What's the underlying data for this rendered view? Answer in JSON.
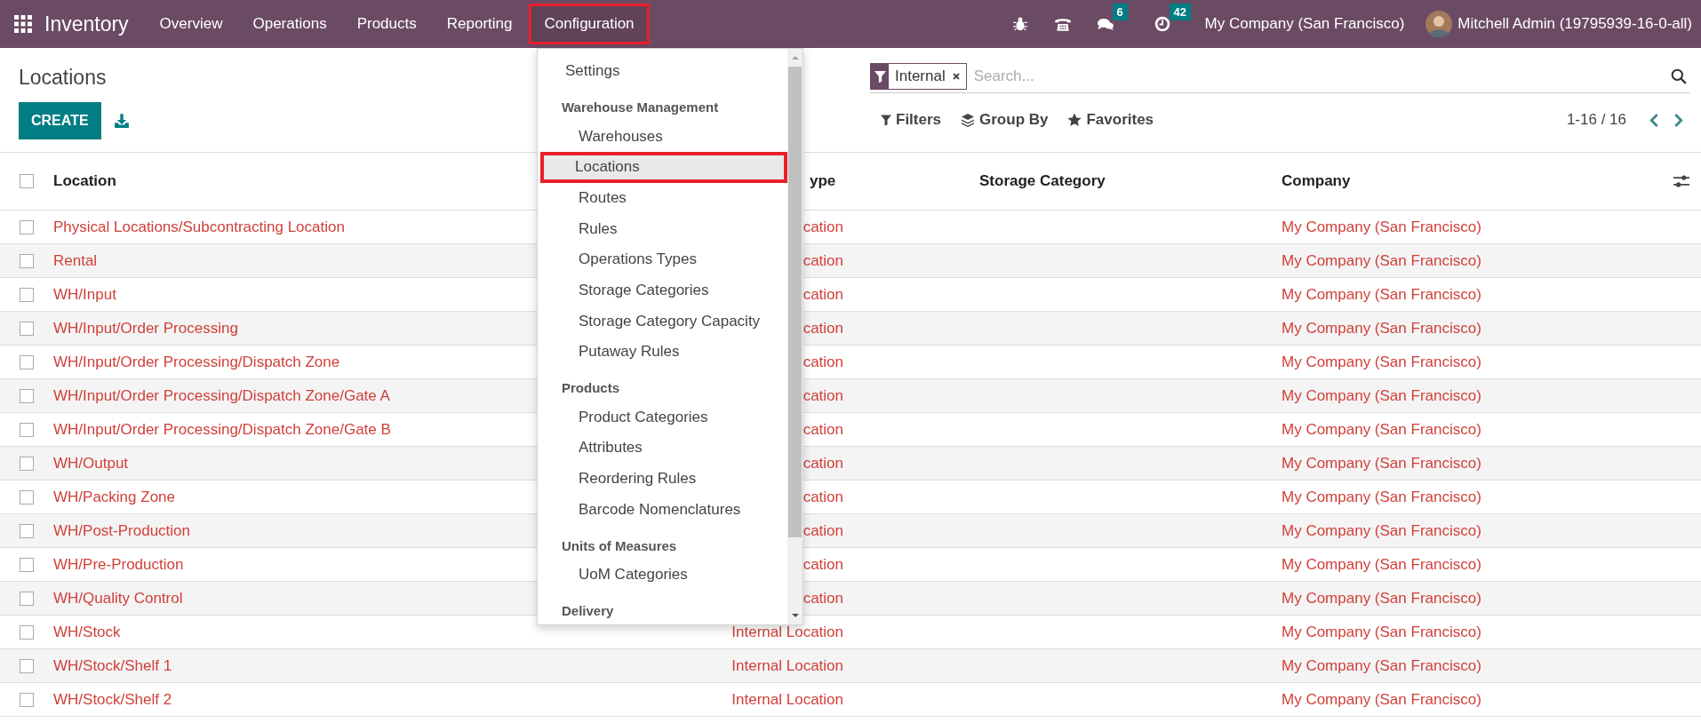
{
  "navbar": {
    "app_name": "Inventory",
    "menu": [
      {
        "label": "Overview",
        "selected": false
      },
      {
        "label": "Operations",
        "selected": false
      },
      {
        "label": "Products",
        "selected": false
      },
      {
        "label": "Reporting",
        "selected": false
      },
      {
        "label": "Configuration",
        "selected": true
      }
    ],
    "messages_badge": "6",
    "activities_badge": "42",
    "company": "My Company (San Francisco)",
    "user": "Mitchell Admin (19795939-16-0-all)"
  },
  "control_panel": {
    "title": "Locations",
    "create_button": "CREATE",
    "search": {
      "facet": "Internal",
      "placeholder": "Search..."
    },
    "filters": "Filters",
    "group_by": "Group By",
    "favorites": "Favorites",
    "pager": "1-16 / 16"
  },
  "dropdown": {
    "items": [
      {
        "kind": "item",
        "label": "Settings",
        "selected": false
      },
      {
        "kind": "header",
        "label": "Warehouse Management"
      },
      {
        "kind": "item",
        "label": "Warehouses",
        "selected": false
      },
      {
        "kind": "item",
        "label": "Locations",
        "selected": true
      },
      {
        "kind": "item",
        "label": "Routes",
        "selected": false
      },
      {
        "kind": "item",
        "label": "Rules",
        "selected": false
      },
      {
        "kind": "item",
        "label": "Operations Types",
        "selected": false
      },
      {
        "kind": "item",
        "label": "Storage Categories",
        "selected": false
      },
      {
        "kind": "item",
        "label": "Storage Category Capacity",
        "selected": false
      },
      {
        "kind": "item",
        "label": "Putaway Rules",
        "selected": false
      },
      {
        "kind": "header",
        "label": "Products"
      },
      {
        "kind": "item",
        "label": "Product Categories",
        "selected": false
      },
      {
        "kind": "item",
        "label": "Attributes",
        "selected": false
      },
      {
        "kind": "item",
        "label": "Reordering Rules",
        "selected": false
      },
      {
        "kind": "item",
        "label": "Barcode Nomenclatures",
        "selected": false
      },
      {
        "kind": "header",
        "label": "Units of Measures"
      },
      {
        "kind": "item",
        "label": "UoM Categories",
        "selected": false
      },
      {
        "kind": "header",
        "label": "Delivery"
      }
    ]
  },
  "table": {
    "header_checked": false,
    "columns": [
      {
        "label": "Location"
      },
      {
        "label": "ype"
      },
      {
        "label": "Storage Category"
      },
      {
        "label": "Company"
      }
    ],
    "rows": [
      {
        "location": "Physical Locations/Subcontracting Location",
        "type": "cation",
        "company": "My Company (San Francisco)",
        "checked": false
      },
      {
        "location": "Rental",
        "type": "cation",
        "company": "My Company (San Francisco)",
        "checked": false
      },
      {
        "location": "WH/Input",
        "type": "cation",
        "company": "My Company (San Francisco)",
        "checked": false
      },
      {
        "location": "WH/Input/Order Processing",
        "type": "cation",
        "company": "My Company (San Francisco)",
        "checked": false
      },
      {
        "location": "WH/Input/Order Processing/Dispatch Zone",
        "type": "cation",
        "company": "My Company (San Francisco)",
        "checked": false
      },
      {
        "location": "WH/Input/Order Processing/Dispatch Zone/Gate A",
        "type": "cation",
        "company": "My Company (San Francisco)",
        "checked": false
      },
      {
        "location": "WH/Input/Order Processing/Dispatch Zone/Gate B",
        "type": "cation",
        "company": "My Company (San Francisco)",
        "checked": false
      },
      {
        "location": "WH/Output",
        "type": "cation",
        "company": "My Company (San Francisco)",
        "checked": false
      },
      {
        "location": "WH/Packing Zone",
        "type": "cation",
        "company": "My Company (San Francisco)",
        "checked": false
      },
      {
        "location": "WH/Post-Production",
        "type": "cation",
        "company": "My Company (San Francisco)",
        "checked": false
      },
      {
        "location": "WH/Pre-Production",
        "type": "cation",
        "company": "My Company (San Francisco)",
        "checked": false
      },
      {
        "location": "WH/Quality Control",
        "type": "cation",
        "company": "My Company (San Francisco)",
        "checked": false
      },
      {
        "location": "WH/Stock",
        "type": "Internal Location",
        "company": "My Company (San Francisco)",
        "checked": false
      },
      {
        "location": "WH/Stock/Shelf 1",
        "type": "Internal Location",
        "company": "My Company (San Francisco)",
        "checked": false
      },
      {
        "location": "WH/Stock/Shelf 2",
        "type": "Internal Location",
        "company": "My Company (San Francisco)",
        "checked": false
      }
    ]
  }
}
